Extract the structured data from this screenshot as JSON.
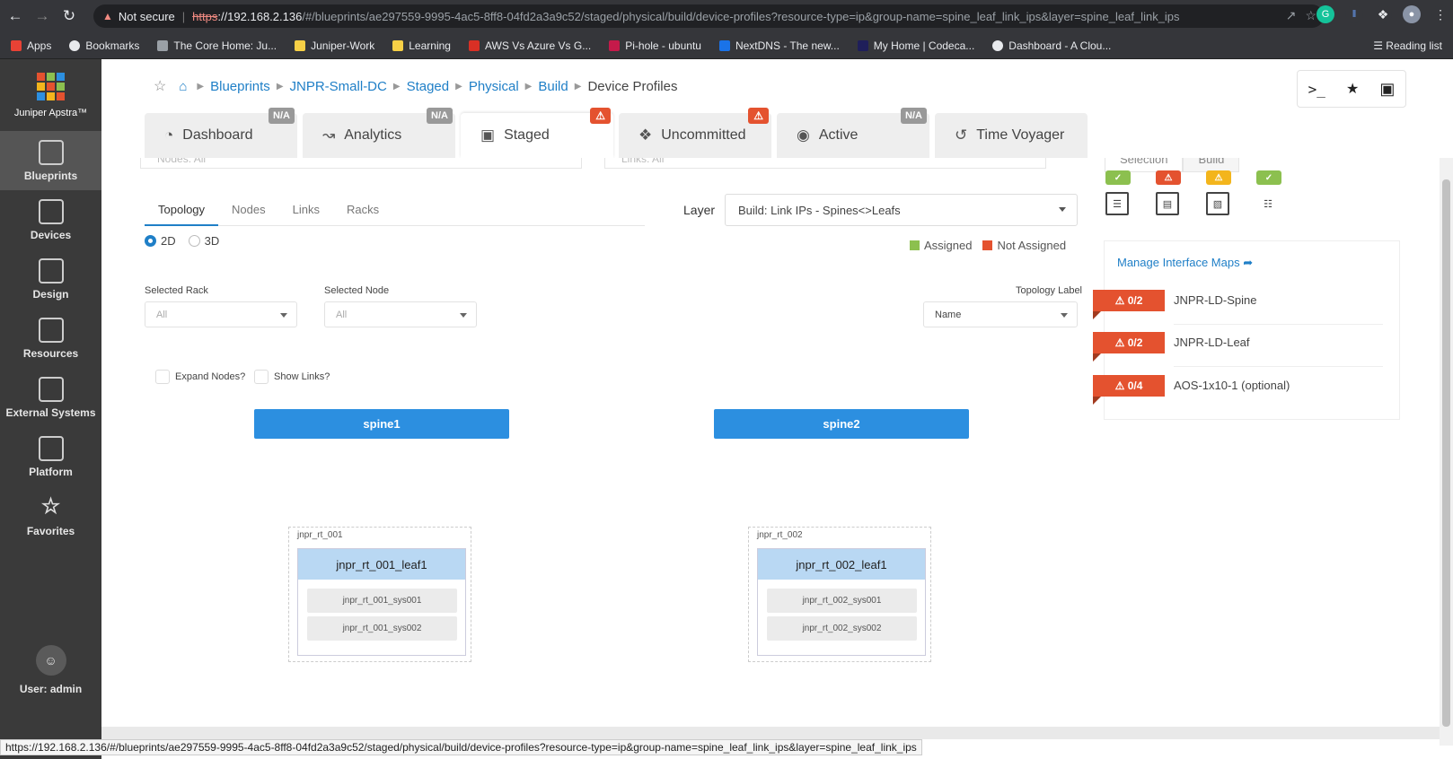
{
  "browser": {
    "security_label": "Not secure",
    "url_proto": "https",
    "url_host": "://192.168.2.136",
    "url_path": "/#/blueprints/ae297559-9995-4ac5-8ff8-04fd2a3a9c52/staged/physical/build/device-profiles?resource-type=ip&group-name=spine_leaf_link_ips&layer=spine_leaf_link_ips",
    "bookmarks": [
      "Apps",
      "Bookmarks",
      "The Core Home: Ju...",
      "Juniper-Work",
      "Learning",
      "AWS Vs Azure Vs G...",
      "Pi-hole - ubuntu",
      "NextDNS - The new...",
      "My Home | Codeca...",
      "Dashboard - A Clou..."
    ],
    "reading_list": "Reading list",
    "status_url": "https://192.168.2.136/#/blueprints/ae297559-9995-4ac5-8ff8-04fd2a3a9c52/staged/physical/build/device-profiles?resource-type=ip&group-name=spine_leaf_link_ips&layer=spine_leaf_link_ips"
  },
  "sidebar": {
    "brand": "Juniper Apstra™",
    "items": [
      {
        "label": "Blueprints"
      },
      {
        "label": "Devices"
      },
      {
        "label": "Design"
      },
      {
        "label": "Resources"
      },
      {
        "label": "External Systems"
      },
      {
        "label": "Platform"
      },
      {
        "label": "Favorites"
      }
    ],
    "user": "User: admin"
  },
  "breadcrumb": [
    "Blueprints",
    "JNPR-Small-DC",
    "Staged",
    "Physical",
    "Build"
  ],
  "breadcrumb_current": "Device Profiles",
  "tabs": [
    {
      "label": "Dashboard",
      "badge": "N/A"
    },
    {
      "label": "Analytics",
      "badge": "N/A"
    },
    {
      "label": "Staged",
      "badge": "⚠"
    },
    {
      "label": "Uncommitted",
      "badge": "⚠"
    },
    {
      "label": "Active",
      "badge": "N/A"
    },
    {
      "label": "Time Voyager",
      "badge": ""
    }
  ],
  "filters": {
    "nodes": "Nodes: All",
    "links": "Links: All"
  },
  "subtabs": [
    "Topology",
    "Nodes",
    "Links",
    "Racks"
  ],
  "view_modes": [
    "2D",
    "3D"
  ],
  "layer": {
    "label": "Layer",
    "value": "Build: Link IPs - Spines<>Leafs"
  },
  "legend": {
    "assigned": "Assigned",
    "not_assigned": "Not Assigned",
    "assigned_color": "#8cc04f",
    "not_assigned_color": "#e4522f"
  },
  "selectors": {
    "rack_label": "Selected Rack",
    "rack_value": "All",
    "node_label": "Selected Node",
    "node_value": "All",
    "topology_label": "Topology Label",
    "topology_value": "Name"
  },
  "checkboxes": {
    "expand_nodes": "Expand Nodes?",
    "show_links": "Show Links?"
  },
  "topology": {
    "spines": [
      "spine1",
      "spine2"
    ],
    "racks": [
      {
        "name": "jnpr_rt_001",
        "leaf": "jnpr_rt_001_leaf1",
        "systems": [
          "jnpr_rt_001_sys001",
          "jnpr_rt_001_sys002"
        ]
      },
      {
        "name": "jnpr_rt_002",
        "leaf": "jnpr_rt_002_leaf1",
        "systems": [
          "jnpr_rt_002_sys001",
          "jnpr_rt_002_sys002"
        ]
      }
    ]
  },
  "right_panel": {
    "tabs": [
      "Selection",
      "Build"
    ],
    "status_icons": [
      {
        "name": "list-icon",
        "status": "ok",
        "color": "#8cc04f"
      },
      {
        "name": "server-icon",
        "status": "error",
        "color": "#e4522f"
      },
      {
        "name": "interface-map-icon",
        "status": "warning",
        "color": "#f3b51c"
      },
      {
        "name": "topology-icon",
        "status": "ok",
        "color": "#8cc04f"
      }
    ],
    "manage_link": "Manage Interface Maps",
    "interface_maps": [
      {
        "badge": "0/2",
        "name": "JNPR-LD-Spine"
      },
      {
        "badge": "0/2",
        "name": "JNPR-LD-Leaf"
      },
      {
        "badge": "0/4",
        "name": "AOS-1x10-1 (optional)"
      }
    ]
  }
}
